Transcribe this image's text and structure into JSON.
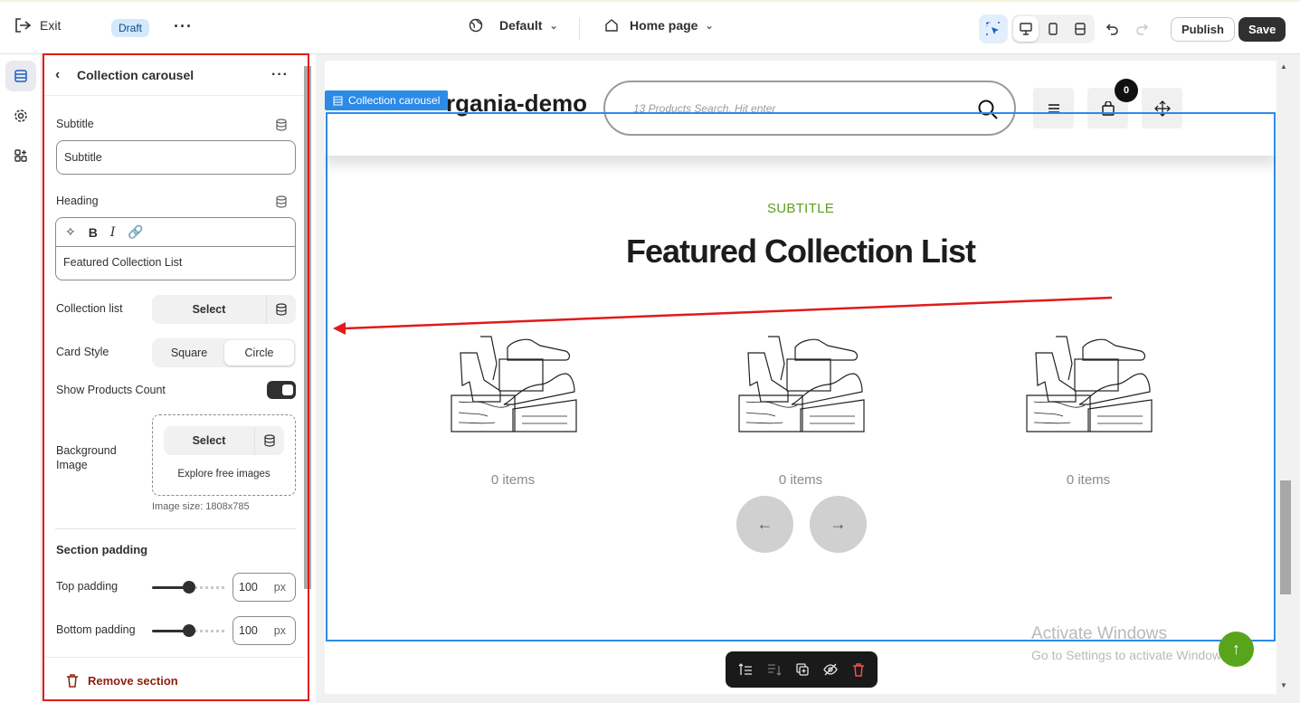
{
  "topbar": {
    "exit_label": "Exit",
    "status_badge": "Draft",
    "theme_label": "Default",
    "page_label": "Home page",
    "publish_label": "Publish",
    "save_label": "Save"
  },
  "panel": {
    "title": "Collection carousel",
    "subtitle_label": "Subtitle",
    "subtitle_value": "Subtitle",
    "heading_label": "Heading",
    "heading_value": "Featured Collection List",
    "collection_list_label": "Collection list",
    "collection_select": "Select",
    "card_style_label": "Card Style",
    "card_style_options": [
      "Square",
      "Circle"
    ],
    "card_style_selected": "Circle",
    "show_products_count_label": "Show Products Count",
    "show_products_count_on": true,
    "background_image_label": "Background Image",
    "background_select": "Select",
    "explore_images": "Explore free images",
    "image_size_note": "Image size: 1808x785",
    "section_padding_title": "Section padding",
    "top_padding_label": "Top padding",
    "top_padding_value": "100",
    "bottom_padding_label": "Bottom padding",
    "bottom_padding_value": "100",
    "unit": "px",
    "remove_section": "Remove section"
  },
  "preview": {
    "logo_text": "rgania-demo",
    "search_placeholder": "13 Products Search, Hit enter",
    "cart_count": "0",
    "section_tag": "Collection carousel",
    "subtitle": "SUBTITLE",
    "heading": "Featured Collection List",
    "cards": [
      {
        "count": "0 items"
      },
      {
        "count": "0 items"
      },
      {
        "count": "0 items"
      }
    ],
    "prev_arrow": "←",
    "next_arrow": "→",
    "watermark_line1": "Activate Windows",
    "watermark_line2": "Go to Settings to activate Windows."
  },
  "colors": {
    "selection_blue": "#2c8ae8",
    "annotation_red": "#e11a1a",
    "subtitle_green": "#5e9e1e",
    "toggle_dark": "#303030"
  }
}
